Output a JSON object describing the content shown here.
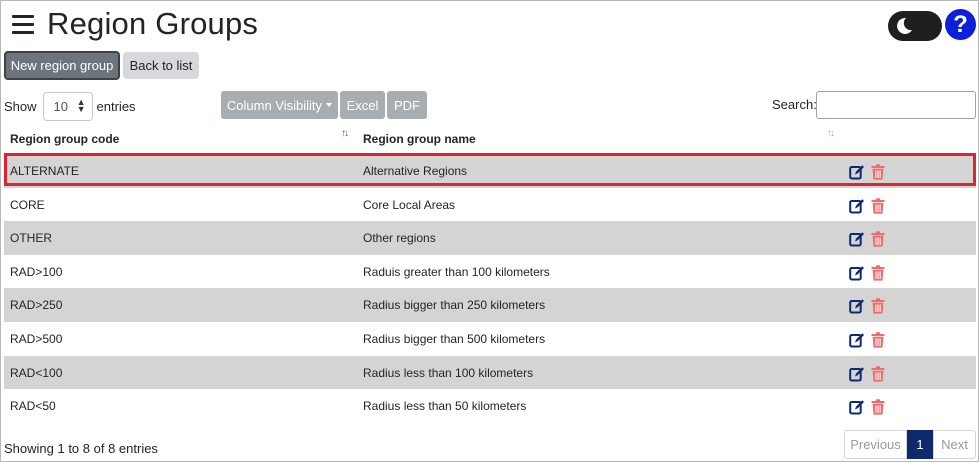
{
  "page": {
    "title": "Region Groups"
  },
  "toolbar": {
    "new_label": "New region group",
    "back_label": "Back to list"
  },
  "length": {
    "show_label": "Show",
    "value": "10",
    "entries_label": "entries"
  },
  "buttons": {
    "colvis": "Column Visibility",
    "excel": "Excel",
    "pdf": "PDF"
  },
  "search": {
    "label": "Search:",
    "placeholder": ""
  },
  "table": {
    "headers": {
      "code": "Region group code",
      "name": "Region group name"
    },
    "sort_icon": "↑↓",
    "rows": [
      {
        "code": "ALTERNATE",
        "name": "Alternative Regions"
      },
      {
        "code": "CORE",
        "name": "Core Local Areas"
      },
      {
        "code": "OTHER",
        "name": "Other regions"
      },
      {
        "code": "RAD>100",
        "name": "Raduis greater than 100 kilometers"
      },
      {
        "code": "RAD>250",
        "name": "Radius bigger than 250 kilometers"
      },
      {
        "code": "RAD>500",
        "name": "Radius bigger than 500 kilometers"
      },
      {
        "code": "RAD<100",
        "name": "Radius less than 100 kilometers"
      },
      {
        "code": "RAD<50",
        "name": "Radius less than 50 kilometers"
      }
    ]
  },
  "footer": {
    "info": "Showing 1 to 8 of 8 entries",
    "prev": "Previous",
    "page": "1",
    "next": "Next"
  },
  "colors": {
    "accent": "#0d2a6e",
    "delete": "#f06b6b",
    "highlight": "#e0242d",
    "help": "#0d1fd8"
  },
  "icons": {
    "menu": "hamburger-icon",
    "theme": "moon-icon",
    "help": "question-icon",
    "edit": "edit-icon",
    "delete": "trash-icon"
  }
}
